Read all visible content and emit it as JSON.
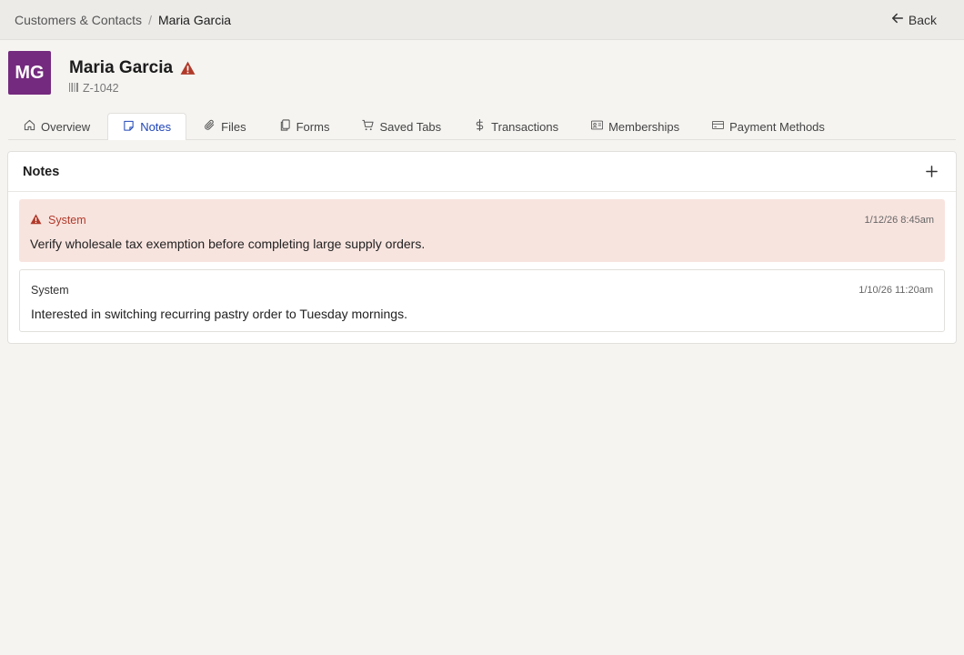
{
  "breadcrumb": {
    "parent": "Customers & Contacts",
    "separator": "/",
    "current": "Maria Garcia"
  },
  "back_label": "Back",
  "profile": {
    "initials": "MG",
    "name": "Maria Garcia",
    "id": "Z-1042",
    "avatar_color": "#742a7e"
  },
  "tabs": [
    {
      "label": "Overview",
      "icon": "home-icon"
    },
    {
      "label": "Notes",
      "icon": "note-icon",
      "active": true
    },
    {
      "label": "Files",
      "icon": "paperclip-icon"
    },
    {
      "label": "Forms",
      "icon": "copy-icon"
    },
    {
      "label": "Saved Tabs",
      "icon": "cart-icon"
    },
    {
      "label": "Transactions",
      "icon": "dollar-icon"
    },
    {
      "label": "Memberships",
      "icon": "id-card-icon"
    },
    {
      "label": "Payment Methods",
      "icon": "credit-card-icon"
    }
  ],
  "notes_panel": {
    "title": "Notes",
    "notes": [
      {
        "author": "System",
        "timestamp": "1/12/26 8:45am",
        "text": "Verify wholesale tax exemption before completing large supply orders.",
        "flagged": true
      },
      {
        "author": "System",
        "timestamp": "1/10/26 11:20am",
        "text": "Interested in switching recurring pastry order to Tuesday mornings.",
        "flagged": false
      }
    ]
  },
  "colors": {
    "accent": "#2046b8",
    "warning": "#b03a2a",
    "alert_bg": "#f8e4df"
  }
}
